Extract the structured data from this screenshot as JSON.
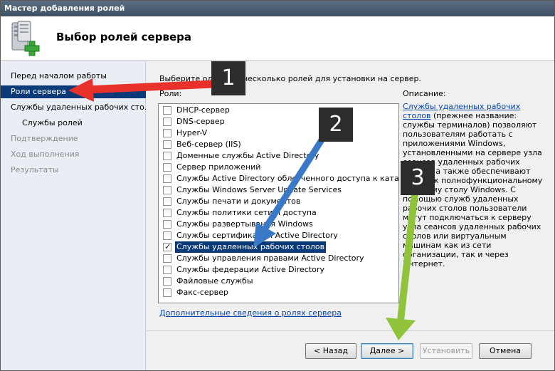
{
  "window": {
    "title": "Мастер добавления ролей"
  },
  "header": {
    "title": "Выбор ролей сервера"
  },
  "nav": {
    "items": [
      {
        "label": "Перед началом работы",
        "state": "normal",
        "sub": false
      },
      {
        "label": "Роли сервера",
        "state": "selected",
        "sub": false
      },
      {
        "label": "Службы удаленных рабочих сто...",
        "state": "normal",
        "sub": false
      },
      {
        "label": "Службы ролей",
        "state": "normal",
        "sub": true
      },
      {
        "label": "Подтверждение",
        "state": "disabled",
        "sub": false
      },
      {
        "label": "Ход выполнения",
        "state": "disabled",
        "sub": false
      },
      {
        "label": "Результаты",
        "state": "disabled",
        "sub": false
      }
    ]
  },
  "main": {
    "instruction": "Выберите одну или несколько ролей для установки на сервер.",
    "roles_label": "Роли:",
    "description_label": "Описание:",
    "roles": [
      {
        "label": "DHCP-сервер",
        "checked": false,
        "selected": false
      },
      {
        "label": "DNS-сервер",
        "checked": false,
        "selected": false
      },
      {
        "label": "Hyper-V",
        "checked": false,
        "selected": false
      },
      {
        "label": "Веб-сервер (IIS)",
        "checked": false,
        "selected": false
      },
      {
        "label": "Доменные службы Active Directory",
        "checked": false,
        "selected": false
      },
      {
        "label": "Сервер приложений",
        "checked": false,
        "selected": false
      },
      {
        "label": "Службы Active Directory облегченного доступа к каталогам",
        "checked": false,
        "selected": false
      },
      {
        "label": "Службы Windows Server Update Services",
        "checked": false,
        "selected": false
      },
      {
        "label": "Службы печати и документов",
        "checked": false,
        "selected": false
      },
      {
        "label": "Службы политики сети и доступа",
        "checked": false,
        "selected": false
      },
      {
        "label": "Службы развертывания Windows",
        "checked": false,
        "selected": false
      },
      {
        "label": "Службы сертификации Active Directory",
        "checked": false,
        "selected": false
      },
      {
        "label": "Службы удаленных рабочих столов",
        "checked": true,
        "selected": true
      },
      {
        "label": "Службы управления правами Active Directory",
        "checked": false,
        "selected": false
      },
      {
        "label": "Службы федерации Active Directory",
        "checked": false,
        "selected": false
      },
      {
        "label": "Файловые службы",
        "checked": false,
        "selected": false
      },
      {
        "label": "Факс-сервер",
        "checked": false,
        "selected": false
      }
    ],
    "more_link": "Дополнительные сведения о ролях сервера",
    "description": {
      "link": "Службы удаленных рабочих столов",
      "text": "(прежнее название: службы терминалов) позволяют пользователям работать с приложениями Windows, установленными на сервере узла сеансов удаленных рабочих столов, а также обеспечивают доступ к полнофункциональному рабочему столу Windows. С помощью служб удаленных рабочих столов пользователи могут подключаться к серверу узла сеансов удаленных рабочих столов или виртуальным машинам как из сети организации, так и через Интернет."
    }
  },
  "footer": {
    "back": "< Назад",
    "next": "Далее >",
    "install": "Установить",
    "cancel": "Отмена"
  },
  "annotations": {
    "callout_1": "1",
    "callout_2": "2",
    "callout_3": "3",
    "colors": {
      "arrow_1": "#e8312a",
      "arrow_2": "#3a78c8",
      "arrow_3": "#8fc43a",
      "callout_bg": "#2d2d2d"
    }
  }
}
